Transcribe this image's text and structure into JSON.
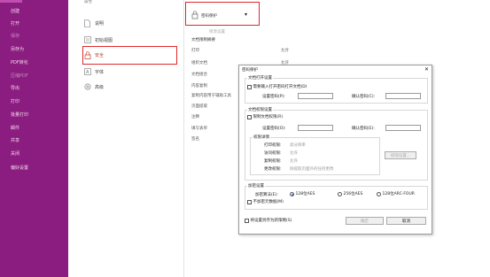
{
  "sidebar": {
    "items": [
      "创建",
      "打开",
      "保存",
      "另存为",
      "PDF转化",
      "压缩PDF",
      "导出",
      "打印",
      "批量打印",
      "邮件",
      "共享",
      "关闭",
      "偏好设置"
    ],
    "dim": [
      false,
      false,
      true,
      false,
      false,
      true,
      false,
      false,
      false,
      false,
      false,
      false,
      false
    ],
    "top_label": "属性"
  },
  "middle": {
    "items": [
      {
        "label": "说明",
        "icon": "document-icon"
      },
      {
        "label": "初始视图",
        "icon": "view-icon"
      },
      {
        "label": "安全",
        "icon": "lock-icon"
      },
      {
        "label": "字体",
        "icon": "font-icon"
      },
      {
        "label": "高级",
        "icon": "gear-icon"
      }
    ]
  },
  "doc_props": {
    "dropdown_label": "密码保护",
    "dropdown_icon": "lock-icon",
    "change_settings": "修改设置",
    "summary_title": "文档限制摘要",
    "rows": [
      {
        "label": "打印",
        "value": "允许"
      },
      {
        "label": "组织文档",
        "value": "允许"
      },
      {
        "label": "文档组合"
      },
      {
        "label": "内容复制"
      },
      {
        "label": "复制内容用于辅助工具"
      },
      {
        "label": "页面提取"
      },
      {
        "label": "注释"
      },
      {
        "label": "填写表单"
      },
      {
        "label": "签名"
      }
    ]
  },
  "dialog": {
    "title": "密码保护",
    "open_group": "文档打开设置",
    "open_check": "需要输入打开密码打开文档(D)",
    "set_pwd": "设置密码(P):",
    "confirm_pwd": "确认密码(C):",
    "perm_group": "文档权限设置",
    "perm_check": "限制文档权限(R)",
    "set_pwd2": "设置密码(O):",
    "confirm_pwd2": "确认密码(E):",
    "perm_detail": "权限详情",
    "perm_rows": [
      {
        "k": "打印权限:",
        "v": "高分辨率"
      },
      {
        "k": "访问权限:",
        "v": "允许"
      },
      {
        "k": "复制权限:",
        "v": "允许"
      },
      {
        "k": "更改权限:",
        "v": "除提取页面外的任何更改"
      }
    ],
    "perm_button": "权限设置...",
    "enc_group": "加密设置",
    "enc_label": "加密算法(E):",
    "enc_opts": [
      "128位AES",
      "256位AES",
      "128位ARC-FOUR"
    ],
    "enc_selected": 0,
    "no_meta": "不加密元数据(M)",
    "save_default": "将设置另存为新策略(S)",
    "ok": "确定",
    "cancel": "取消"
  }
}
